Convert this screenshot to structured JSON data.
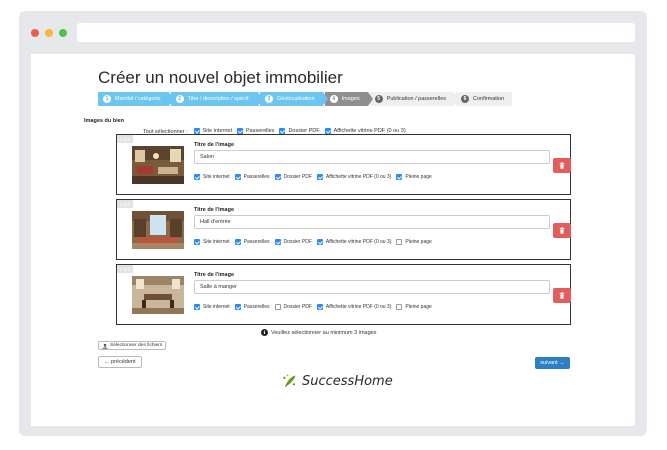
{
  "window": {
    "controls": [
      "close",
      "minimize",
      "maximize"
    ]
  },
  "page": {
    "title": "Créer un nouvel objet immobilier",
    "steps": [
      {
        "num": "1",
        "label": "Mandat / catégorie",
        "state": "done"
      },
      {
        "num": "2",
        "label": "Titre / description / spécif.",
        "state": "done"
      },
      {
        "num": "3",
        "label": "Géolocalisation",
        "state": "done"
      },
      {
        "num": "4",
        "label": "Images",
        "state": "current"
      },
      {
        "num": "5",
        "label": "Publication / passerelles",
        "state": "todo"
      },
      {
        "num": "6",
        "label": "Confirmation",
        "state": "todo"
      }
    ],
    "section_label": "Images du bien",
    "select_all": {
      "label": "Tout sélectionner :",
      "options": [
        {
          "label": "Site internet",
          "checked": true
        },
        {
          "label": "Passerelles",
          "checked": true
        },
        {
          "label": "Dossier PDF",
          "checked": true
        },
        {
          "label": "Affichette vitrine PDF (0 ou 3)",
          "checked": true
        }
      ]
    },
    "images": [
      {
        "badge": "≡ 1/3",
        "field_label": "Titre de l'image",
        "title_value": "Salon",
        "options": [
          {
            "label": "Site internet",
            "checked": true
          },
          {
            "label": "Passerelles",
            "checked": true
          },
          {
            "label": "Dossier PDF",
            "checked": true
          },
          {
            "label": "Affichette vitrine PDF (0 ou 3)",
            "checked": true
          },
          {
            "label": "Pleine page",
            "checked": true
          }
        ]
      },
      {
        "badge": "≡ 2/3",
        "field_label": "Titre de l'image",
        "title_value": "Hall d'entrée",
        "options": [
          {
            "label": "Site internet",
            "checked": true
          },
          {
            "label": "Passerelles",
            "checked": true
          },
          {
            "label": "Dossier PDF",
            "checked": true
          },
          {
            "label": "Affichette vitrine PDF (0 ou 3)",
            "checked": true
          },
          {
            "label": "Pleine page",
            "checked": false
          }
        ]
      },
      {
        "badge": "≡ 3/3",
        "field_label": "Titre de l'image",
        "title_value": "Salle à manger",
        "options": [
          {
            "label": "Site internet",
            "checked": true
          },
          {
            "label": "Passerelles",
            "checked": true
          },
          {
            "label": "Dossier PDF",
            "checked": false
          },
          {
            "label": "Affichette vitrine PDF (0 ou 3)",
            "checked": true
          },
          {
            "label": "Pleine page",
            "checked": false
          }
        ]
      }
    ],
    "notice": "Veuillez sélectionner au minimum 3 images",
    "select_files_label": "Sélectionner des fichiers",
    "prev_label": "← précédent",
    "next_label": "suivant →",
    "logo_text": "SuccessHome",
    "colors": {
      "step_done": "#6cc5ef",
      "step_current": "#8f8f8f",
      "step_todo": "#efefef",
      "checkbox": "#2d8cf0",
      "delete_button": "#e35d5d",
      "next_button": "#2d7fc5"
    }
  }
}
